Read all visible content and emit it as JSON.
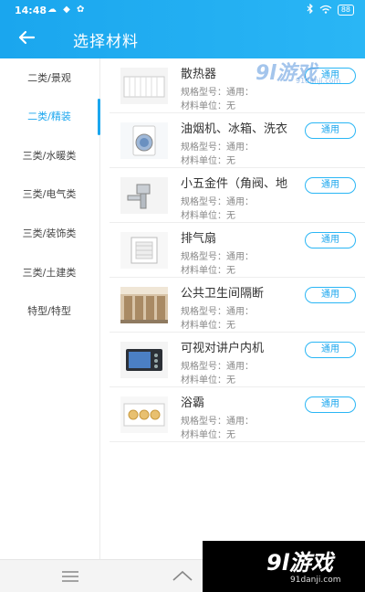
{
  "status_bar": {
    "time": "14:48",
    "notification_icons": "☁ ◆ ✿",
    "battery": "88"
  },
  "header": {
    "title": "选择材料",
    "back_icon": "arrow-left-icon"
  },
  "sidebar": {
    "items": [
      {
        "label": "二类/景观"
      },
      {
        "label": "二类/精装"
      },
      {
        "label": "三类/水暖类"
      },
      {
        "label": "三类/电气类"
      },
      {
        "label": "三类/装饰类"
      },
      {
        "label": "三类/土建类"
      },
      {
        "label": "特型/特型"
      }
    ],
    "active_index": 1
  },
  "materials": [
    {
      "name": "散热器",
      "spec": "规格型号：通用：",
      "unit": "材料单位：无",
      "tag": "通用"
    },
    {
      "name": "油烟机、冰箱、洗衣",
      "spec": "规格型号：通用：",
      "unit": "材料单位：无",
      "tag": "通用"
    },
    {
      "name": "小五金件（角阀、地",
      "spec": "规格型号：通用：",
      "unit": "材料单位：无",
      "tag": "通用"
    },
    {
      "name": "排气扇",
      "spec": "规格型号：通用：",
      "unit": "材料单位：无",
      "tag": "通用"
    },
    {
      "name": "公共卫生间隔断",
      "spec": "规格型号：通用：",
      "unit": "材料单位：无",
      "tag": "通用"
    },
    {
      "name": "可视对讲户内机",
      "spec": "规格型号：通用：",
      "unit": "材料单位：无",
      "tag": "通用"
    },
    {
      "name": "浴霸",
      "spec": "规格型号：通用：",
      "unit": "材料单位：无",
      "tag": "通用"
    }
  ],
  "watermark": {
    "top_big": "9l游戏",
    "top_small": "91danji.com",
    "bottom_big": "9l游戏",
    "bottom_small": "91danji.com"
  },
  "colors": {
    "accent": "#1aa6ee",
    "header_bg": "#2ab6f5"
  }
}
